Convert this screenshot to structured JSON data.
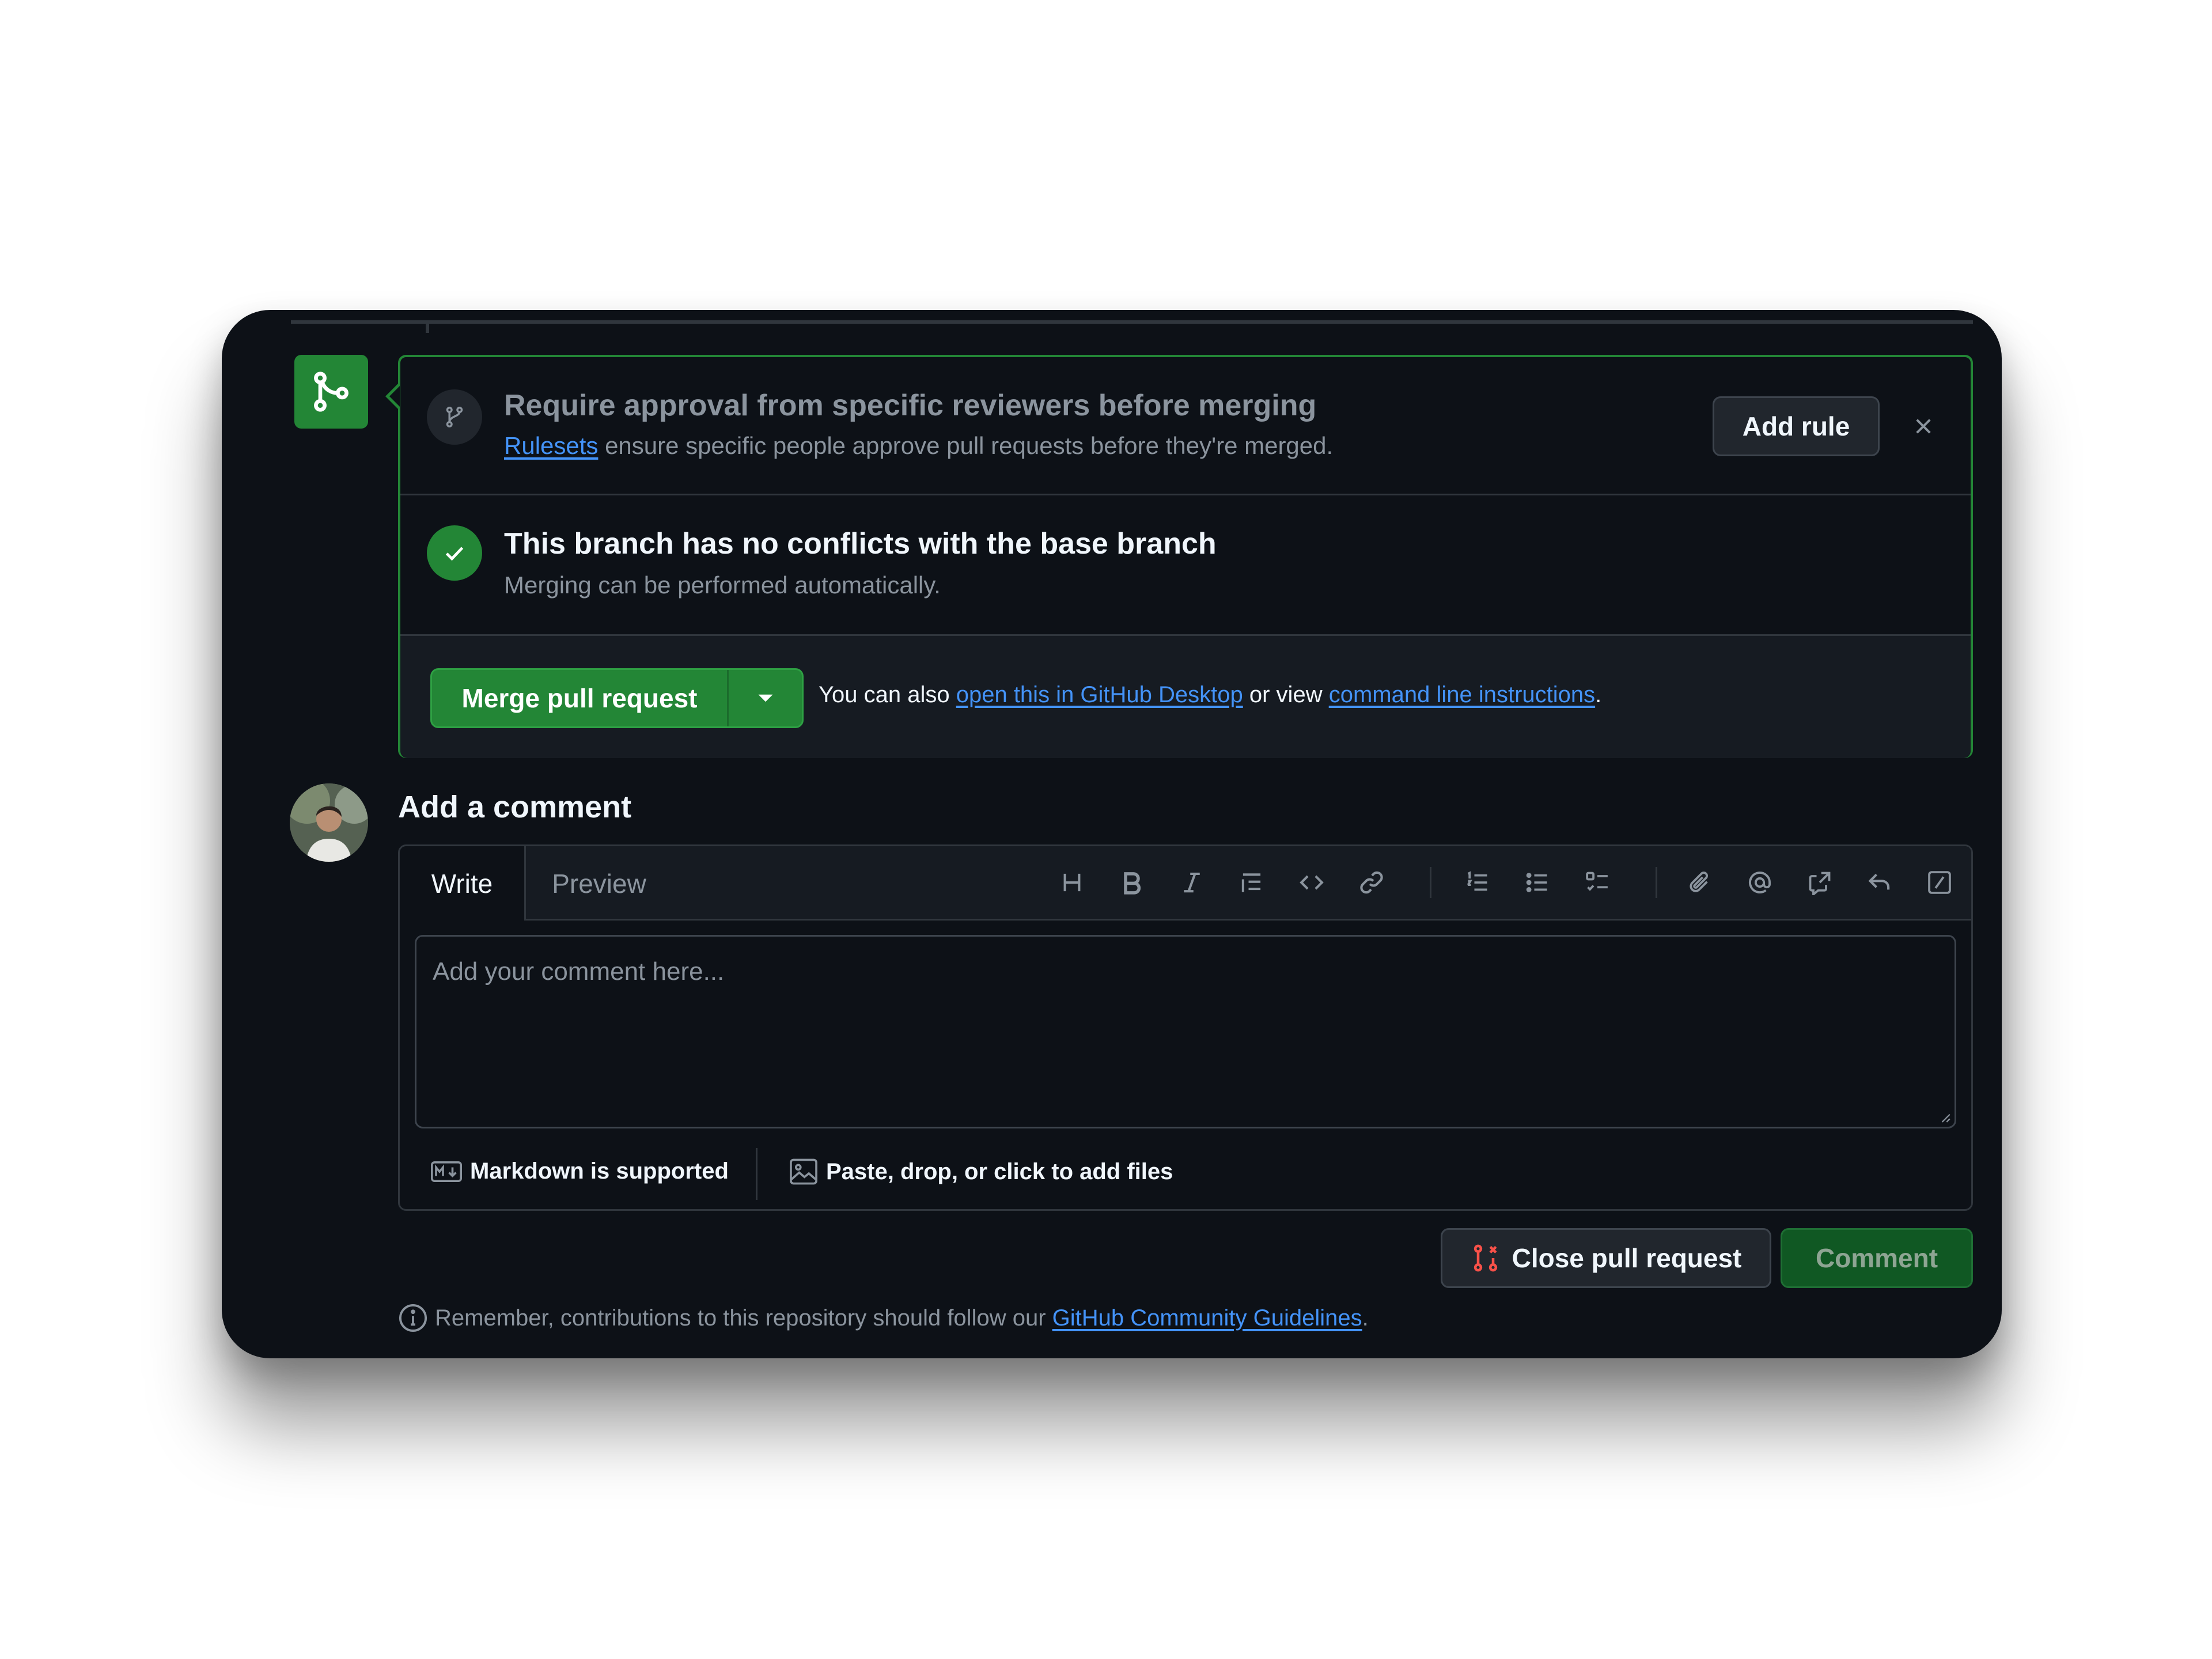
{
  "ruleset_prompt": {
    "title": "Require approval from specific reviewers before merging",
    "link_text": "Rulesets",
    "subtitle_rest": " ensure specific people approve pull requests before they're merged.",
    "add_rule_label": "Add rule",
    "icon": "git-branch-icon"
  },
  "conflicts": {
    "title": "This branch has no conflicts with the base branch",
    "subtitle": "Merging can be performed automatically.",
    "icon": "check-icon"
  },
  "merge": {
    "button_label": "Merge pull request",
    "note_prefix": "You can also ",
    "desktop_link": "open this in GitHub Desktop",
    "note_middle": " or view ",
    "cli_link": "command line instructions",
    "note_suffix": "."
  },
  "comment": {
    "heading": "Add a comment",
    "tabs": [
      "Write",
      "Preview"
    ],
    "active_tab": "Write",
    "placeholder": "Add your comment here...",
    "markdown_note": "Markdown is supported",
    "files_note": "Paste, drop, or click to add files",
    "toolbar_icons": [
      "heading-icon",
      "bold-icon",
      "italic-icon",
      "quote-icon",
      "code-icon",
      "link-icon",
      "ordered-list-icon",
      "unordered-list-icon",
      "task-list-icon",
      "attach-icon",
      "mention-icon",
      "cross-reference-icon",
      "saved-reply-icon",
      "slash-command-icon"
    ]
  },
  "actions": {
    "close_label": "Close pull request",
    "comment_label": "Comment"
  },
  "guidelines": {
    "prefix": "Remember, contributions to this repository should follow our ",
    "link": "GitHub Community Guidelines",
    "suffix": "."
  },
  "colors": {
    "background": "#0d1117",
    "success": "#238636",
    "link": "#4493f8",
    "danger": "#f85149",
    "muted_text": "#8b949e"
  }
}
